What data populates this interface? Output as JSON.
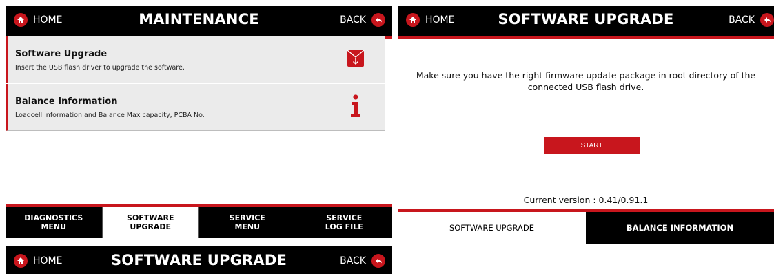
{
  "maintenance": {
    "home_label": "HOME",
    "title": "MAINTENANCE",
    "back_label": "BACK",
    "items": [
      {
        "title": "Software Upgrade",
        "subtitle": "Insert the USB flash driver to upgrade the software.",
        "icon": "usb-download-icon"
      },
      {
        "title": "Balance Information",
        "subtitle": "Loadcell information and Balance Max capacity, PCBA No.",
        "icon": "info-icon"
      }
    ],
    "tabs": [
      {
        "label": "DIAGNOSTICS\nMENU"
      },
      {
        "label": "SOFTWARE\nUPGRADE"
      },
      {
        "label": "SERVICE\nMENU"
      },
      {
        "label": "SERVICE\nLOG FILE"
      }
    ]
  },
  "upgrade": {
    "home_label": "HOME",
    "title": "SOFTWARE UPGRADE",
    "back_label": "BACK",
    "message": "Make sure you have the right firmware update package in root directory of the connected USB flash drive.",
    "start_label": "START",
    "version_text": "Current version : 0.41/0.91.1",
    "tabs": [
      {
        "label": "SOFTWARE UPGRADE"
      },
      {
        "label": "BALANCE INFORMATION"
      }
    ]
  },
  "upgrade2": {
    "home_label": "HOME",
    "title": "SOFTWARE UPGRADE",
    "back_label": "BACK"
  },
  "colors": {
    "accent": "#c8161d",
    "bar": "#000000",
    "row_bg": "#ebebeb"
  }
}
